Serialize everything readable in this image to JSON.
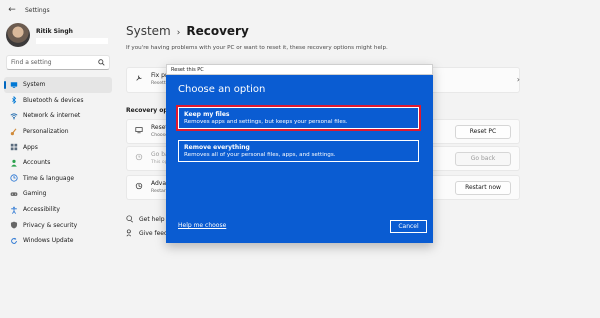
{
  "window": {
    "title": "Settings",
    "back_icon": "back-arrow-icon"
  },
  "profile": {
    "name": "Ritik Singh"
  },
  "search": {
    "placeholder": "Find a setting"
  },
  "nav": [
    {
      "label": "System",
      "icon": "monitor-icon",
      "color": "#0078d4",
      "active": true
    },
    {
      "label": "Bluetooth & devices",
      "icon": "bluetooth-icon",
      "color": "#0078d4"
    },
    {
      "label": "Network & internet",
      "icon": "wifi-icon",
      "color": "#0d5ea8"
    },
    {
      "label": "Personalization",
      "icon": "brush-icon",
      "color": "#d08a3a"
    },
    {
      "label": "Apps",
      "icon": "apps-icon",
      "color": "#5a6b7d"
    },
    {
      "label": "Accounts",
      "icon": "person-icon",
      "color": "#2ba14d"
    },
    {
      "label": "Time & language",
      "icon": "globe-clock-icon",
      "color": "#1f6fd1"
    },
    {
      "label": "Gaming",
      "icon": "gamepad-icon",
      "color": "#666666"
    },
    {
      "label": "Accessibility",
      "icon": "accessibility-icon",
      "color": "#1f6fd1"
    },
    {
      "label": "Privacy & security",
      "icon": "shield-icon",
      "color": "#666666"
    },
    {
      "label": "Windows Update",
      "icon": "update-icon",
      "color": "#1f6fd1"
    }
  ],
  "header": {
    "crumb": "System",
    "separator": "›",
    "current": "Recovery"
  },
  "intro": "If you're having problems with your PC or want to reset it, these recovery options might help.",
  "fix_card": {
    "title": "Fix pro",
    "subtitle": "Resetti"
  },
  "recovery_label": "Recovery optio",
  "rows": [
    {
      "title": "Reset",
      "subtitle": "Choose",
      "button": "Reset PC",
      "disabled": false
    },
    {
      "title": "Go ba",
      "subtitle": "This op",
      "button": "Go back",
      "disabled": true
    },
    {
      "title": "Advan",
      "subtitle": "Restart",
      "button": "Restart now",
      "disabled": false
    }
  ],
  "help_links": [
    {
      "label": "Get help",
      "icon": "help-icon"
    },
    {
      "label": "Give feedl",
      "icon": "feedback-icon"
    }
  ],
  "dialog": {
    "window_title": "Reset this PC",
    "heading": "Choose an option",
    "options": [
      {
        "title": "Keep my files",
        "description": "Removes apps and settings, but keeps your personal files."
      },
      {
        "title": "Remove everything",
        "description": "Removes all of your personal files, apps, and settings."
      }
    ],
    "help_link": "Help me choose",
    "cancel": "Cancel",
    "highlight_color": "#e0182e",
    "bg_color": "#0a5cd2"
  }
}
